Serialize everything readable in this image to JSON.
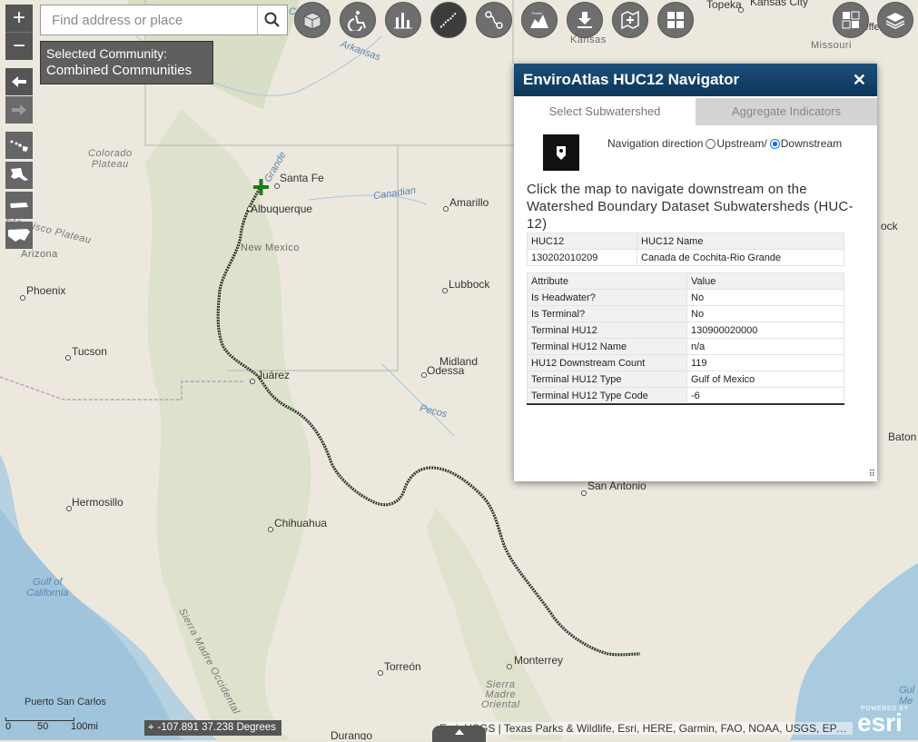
{
  "search": {
    "placeholder": "Find address or place"
  },
  "community": {
    "line1": "Selected Community:",
    "line2": "Combined Communities"
  },
  "zoom": {
    "in": "+",
    "out": "−"
  },
  "panel": {
    "title": "EnviroAtlas HUC12 Navigator",
    "close": "✕",
    "tab_active": "Select Subwatershed",
    "tab_inactive": "Aggregate Indicators",
    "nav_label": "Navigation direction",
    "upstream": "Upstream/",
    "downstream": "Downstream",
    "selected_direction": "Downstream",
    "instruction": "Click the map to navigate downstream on the Watershed Boundary Dataset Subwatersheds (HUC-12)",
    "table1": {
      "h1": "HUC12",
      "h2": "HUC12 Name",
      "v1": "130202010209",
      "v2": "Canada de Cochita-Rio Grande"
    },
    "table2": {
      "h1": "Attribute",
      "h2": "Value",
      "rows": [
        {
          "k": "Is Headwater?",
          "v": "No"
        },
        {
          "k": "Is Terminal?",
          "v": "No"
        },
        {
          "k": "Terminal HU12",
          "v": "130900020000"
        },
        {
          "k": "Terminal HU12 Name",
          "v": "n/a"
        },
        {
          "k": "HU12 Downstream Count",
          "v": "119"
        },
        {
          "k": "Terminal HU12 Type",
          "v": "Gulf of Mexico"
        },
        {
          "k": "Terminal HU12 Type Code",
          "v": "-6"
        }
      ]
    }
  },
  "coords": "-107.891 37.238 Degrees",
  "attribution": "Esri, USGS | Texas Parks & Wildlife, Esri, HERE, Garmin, FAO, NOAA, USGS, EPA, NPS",
  "scale": {
    "l0": "0",
    "l1": "50",
    "l2": "100mi"
  },
  "esri": {
    "powered": "POWERED BY",
    "logo": "esri"
  },
  "places": {
    "santa_fe": "Santa Fe",
    "albuquerque": "Albuquerque",
    "new_mexico": "New Mexico",
    "amarillo": "Amarillo",
    "lubbock": "Lubbock",
    "midland": "Midland",
    "odessa": "Odessa",
    "phoenix": "Phoenix",
    "tucson": "Tucson",
    "arizona": "Arizona",
    "juarez": "Juárez",
    "hermosillo": "Hermosillo",
    "chihuahua": "Chihuahua",
    "torreon": "Torreón",
    "monterrey": "Monterrey",
    "san_antonio": "San Antonio",
    "puerto_san_carlos": "Puerto San Carlos",
    "topeka": "Topeka",
    "kansas_city": "Kansas City",
    "kansas": "Kansas",
    "missouri": "Missouri",
    "jefferson": "Jefferson",
    "colorado": "Colorado",
    "colorado_plateau": "Colorado\nPlateau",
    "francisco_plateau": "Francisco Plateau",
    "canadian": "Canadian",
    "pecos": "Pecos",
    "arkansas": "Arkansas",
    "grande": "Grande",
    "gulf_california": "Gulf of\nCalifornia",
    "sierra_madre_occ": "Sierra Madre Occidental",
    "sierra_madre": "Sierra\nMadre\nOriental",
    "baton": "Baton",
    "rock": "ock",
    "gulf": "Gul\nMe",
    "durango": "Durango"
  }
}
